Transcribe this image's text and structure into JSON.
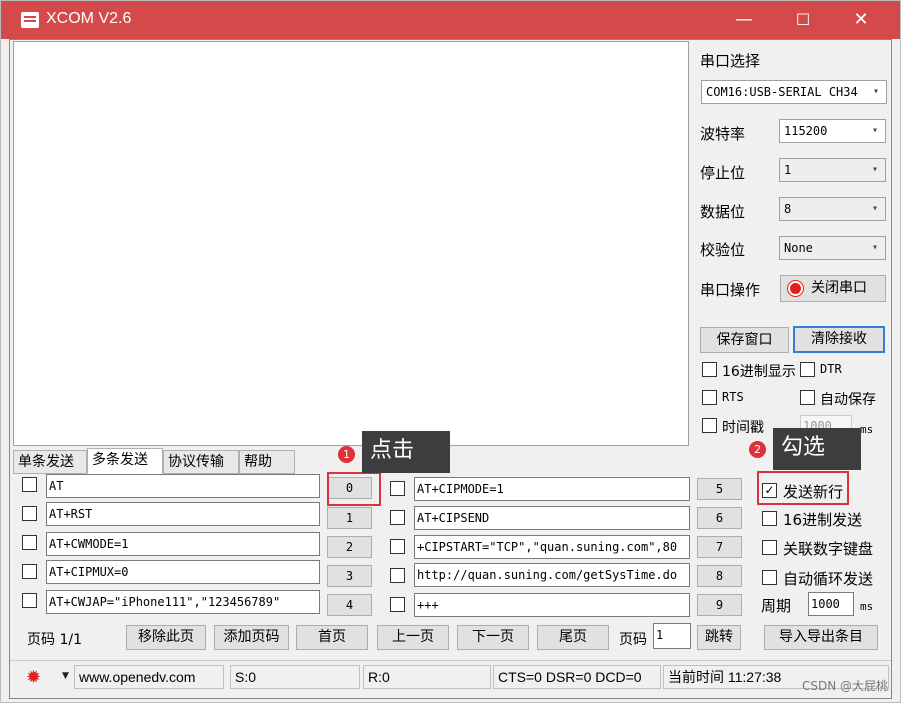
{
  "window": {
    "title": "XCOM V2.6",
    "min_glyph": "—",
    "max_glyph": "☐",
    "close_glyph": "✕"
  },
  "serial": {
    "port_select_label": "串口选择",
    "port_value": "COM16:USB-SERIAL CH34",
    "baud_label": "波特率",
    "baud_value": "115200",
    "stopbits_label": "停止位",
    "stopbits_value": "1",
    "databits_label": "数据位",
    "databits_value": "8",
    "parity_label": "校验位",
    "parity_value": "None",
    "port_op_label": "串口操作",
    "close_port_button": "关闭串口",
    "save_window_button": "保存窗口",
    "clear_recv_button": "清除接收",
    "hex_display_label": "16进制显示",
    "dtr_label": "DTR",
    "rts_label": "RTS",
    "auto_save_label": "自动保存",
    "timestamp_label": "时间戳",
    "timestamp_value": "1000",
    "timestamp_unit": "ms"
  },
  "tabs": [
    "单条发送",
    "多条发送",
    "协议传输",
    "帮助"
  ],
  "multi_send": {
    "left": [
      {
        "text": "AT",
        "btn": "0"
      },
      {
        "text": "AT+RST",
        "btn": "1"
      },
      {
        "text": "AT+CWMODE=1",
        "btn": "2"
      },
      {
        "text": "AT+CIPMUX=0",
        "btn": "3"
      },
      {
        "text": "AT+CWJAP=\"iPhone111\",\"123456789\"",
        "btn": "4"
      }
    ],
    "right": [
      {
        "text": "AT+CIPMODE=1",
        "btn": "5"
      },
      {
        "text": "AT+CIPSEND",
        "btn": "6"
      },
      {
        "text": "+CIPSTART=\"TCP\",\"quan.suning.com\",80",
        "btn": "7"
      },
      {
        "text": "http://quan.suning.com/getSysTime.do",
        "btn": "8"
      },
      {
        "text": "+++",
        "btn": "9"
      }
    ],
    "send_newline_label": "发送新行",
    "hex_send_label": "16进制发送",
    "link_keypad_label": "关联数字键盘",
    "auto_loop_label": "自动循环发送",
    "period_label": "周期",
    "period_value": "1000",
    "period_unit": "ms",
    "page_label": "页码 1/1",
    "remove_page_button": "移除此页",
    "add_page_button": "添加页码",
    "first_page_button": "首页",
    "prev_page_button": "上一页",
    "next_page_button": "下一页",
    "last_page_button": "尾页",
    "page_num_label": "页码",
    "page_num_value": "1",
    "jump_button": "跳转",
    "import_export_button": "导入导出条目"
  },
  "annotations": {
    "step1_badge": "1",
    "step1_text": "点击",
    "step2_badge": "2",
    "step2_text": "勾选"
  },
  "status": {
    "url": "www.openedv.com",
    "sent": "S:0",
    "recv": "R:0",
    "lines": "CTS=0 DSR=0 DCD=0",
    "time": "当前时间 11:27:38"
  },
  "watermark": "CSDN @大屁桃",
  "colors": {
    "titlebar": "#d44a4a",
    "annotation_red": "#e0303a",
    "callout_bg": "#3d3d3d"
  }
}
